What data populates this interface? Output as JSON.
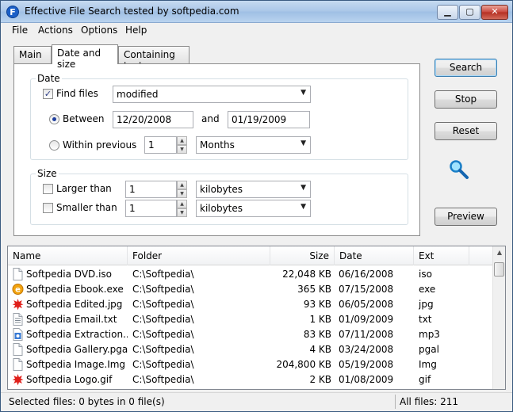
{
  "window": {
    "title": "Effective File Search tested by softpedia.com"
  },
  "menu": [
    "File",
    "Actions",
    "Options",
    "Help"
  ],
  "tabs": [
    {
      "label": "Main",
      "active": false
    },
    {
      "label": "Date and size",
      "active": true
    },
    {
      "label": "Containing text",
      "active": false
    }
  ],
  "date_group": {
    "title": "Date",
    "find_files": {
      "label": "Find files",
      "checked": true,
      "mode": "modified"
    },
    "between": {
      "label": "Between",
      "selected": true,
      "from": "12/20/2008",
      "and_label": "and",
      "to": "01/19/2009"
    },
    "within": {
      "label": "Within previous",
      "selected": false,
      "value": "1",
      "unit": "Months"
    }
  },
  "size_group": {
    "title": "Size",
    "larger": {
      "label": "Larger than",
      "checked": false,
      "value": "1",
      "unit": "kilobytes"
    },
    "smaller": {
      "label": "Smaller than",
      "checked": false,
      "value": "1",
      "unit": "kilobytes"
    }
  },
  "buttons": {
    "search": "Search",
    "stop": "Stop",
    "reset": "Reset",
    "preview": "Preview"
  },
  "results": {
    "columns": [
      "Name",
      "Folder",
      "Size",
      "Date",
      "Ext"
    ],
    "rows": [
      {
        "name": "Softpedia DVD.iso",
        "folder": "C:\\Softpedia\\",
        "size": "22,048 KB",
        "date": "06/16/2008",
        "ext": "iso",
        "icon": "file-icon"
      },
      {
        "name": "Softpedia Ebook.exe",
        "folder": "C:\\Softpedia\\",
        "size": "365 KB",
        "date": "07/15/2008",
        "ext": "exe",
        "icon": "ie-icon"
      },
      {
        "name": "Softpedia Edited.jpg",
        "folder": "C:\\Softpedia\\",
        "size": "93 KB",
        "date": "06/05/2008",
        "ext": "jpg",
        "icon": "splat-icon"
      },
      {
        "name": "Softpedia Email.txt",
        "folder": "C:\\Softpedia\\",
        "size": "1 KB",
        "date": "01/09/2009",
        "ext": "txt",
        "icon": "text-file-icon"
      },
      {
        "name": "Softpedia Extraction....",
        "folder": "C:\\Softpedia\\",
        "size": "83 KB",
        "date": "07/11/2008",
        "ext": "mp3",
        "icon": "audio-file-icon"
      },
      {
        "name": "Softpedia Gallery.pgal",
        "folder": "C:\\Softpedia\\",
        "size": "4 KB",
        "date": "03/24/2008",
        "ext": "pgal",
        "icon": "file-icon"
      },
      {
        "name": "Softpedia Image.Img",
        "folder": "C:\\Softpedia\\",
        "size": "204,800 KB",
        "date": "05/19/2008",
        "ext": "Img",
        "icon": "file-icon"
      },
      {
        "name": "Softpedia Logo.gif",
        "folder": "C:\\Softpedia\\",
        "size": "2 KB",
        "date": "01/08/2009",
        "ext": "gif",
        "icon": "splat-icon"
      }
    ]
  },
  "status": {
    "selected": "Selected files: 0 bytes in 0 file(s)",
    "all": "All files: 211"
  },
  "colors": {
    "accent": "#1f3f9e",
    "splat": "#e0201b",
    "ie": "#f2a30f"
  }
}
